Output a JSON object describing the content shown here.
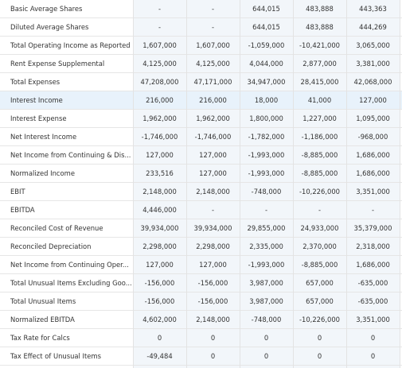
{
  "rows": [
    {
      "label": "Basic Average Shares",
      "values": [
        "-",
        "-",
        "644,015",
        "483,888",
        "443,363"
      ]
    },
    {
      "label": "Diluted Average Shares",
      "values": [
        "-",
        "-",
        "644,015",
        "483,888",
        "444,269"
      ]
    },
    {
      "label": "Total Operating Income as Reported",
      "values": [
        "1,607,000",
        "1,607,000",
        "-1,059,000",
        "-10,421,000",
        "3,065,000"
      ]
    },
    {
      "label": "Rent Expense Supplemental",
      "values": [
        "4,125,000",
        "4,125,000",
        "4,044,000",
        "2,877,000",
        "3,381,000"
      ]
    },
    {
      "label": "Total Expenses",
      "values": [
        "47,208,000",
        "47,171,000",
        "34,947,000",
        "28,415,000",
        "42,068,000"
      ]
    },
    {
      "label": "Interest Income",
      "values": [
        "216,000",
        "216,000",
        "18,000",
        "41,000",
        "127,000"
      ]
    },
    {
      "label": "Interest Expense",
      "values": [
        "1,962,000",
        "1,962,000",
        "1,800,000",
        "1,227,000",
        "1,095,000"
      ]
    },
    {
      "label": "Net Interest Income",
      "values": [
        "-1,746,000",
        "-1,746,000",
        "-1,782,000",
        "-1,186,000",
        "-968,000"
      ]
    },
    {
      "label": "Net Income from Continuing & Dis...",
      "values": [
        "127,000",
        "127,000",
        "-1,993,000",
        "-8,885,000",
        "1,686,000"
      ]
    },
    {
      "label": "Normalized Income",
      "values": [
        "233,516",
        "127,000",
        "-1,993,000",
        "-8,885,000",
        "1,686,000"
      ]
    },
    {
      "label": "EBIT",
      "values": [
        "2,148,000",
        "2,148,000",
        "-748,000",
        "-10,226,000",
        "3,351,000"
      ]
    },
    {
      "label": "EBITDA",
      "values": [
        "4,446,000",
        "-",
        "-",
        "-",
        "-"
      ]
    },
    {
      "label": "Reconciled Cost of Revenue",
      "values": [
        "39,934,000",
        "39,934,000",
        "29,855,000",
        "24,933,000",
        "35,379,000"
      ]
    },
    {
      "label": "Reconciled Depreciation",
      "values": [
        "2,298,000",
        "2,298,000",
        "2,335,000",
        "2,370,000",
        "2,318,000"
      ]
    },
    {
      "label": "Net Income from Continuing Oper...",
      "values": [
        "127,000",
        "127,000",
        "-1,993,000",
        "-8,885,000",
        "1,686,000"
      ]
    },
    {
      "label": "Total Unusual Items Excluding Goo...",
      "values": [
        "-156,000",
        "-156,000",
        "3,987,000",
        "657,000",
        "-635,000"
      ]
    },
    {
      "label": "Total Unusual Items",
      "values": [
        "-156,000",
        "-156,000",
        "3,987,000",
        "657,000",
        "-635,000"
      ]
    },
    {
      "label": "Normalized EBITDA",
      "values": [
        "4,602,000",
        "2,148,000",
        "-748,000",
        "-10,226,000",
        "3,351,000"
      ]
    },
    {
      "label": "Tax Rate for Calcs",
      "values": [
        "0",
        "0",
        "0",
        "0",
        "0"
      ]
    },
    {
      "label": "Tax Effect of Unusual Items",
      "values": [
        "-49,484",
        "0",
        "0",
        "0",
        "0"
      ]
    }
  ],
  "colors": {
    "highlight_row": "#e8f2fb",
    "column_shade": "#f2f6fa",
    "grid_line": "#e3e3e3",
    "text": "#333333"
  }
}
